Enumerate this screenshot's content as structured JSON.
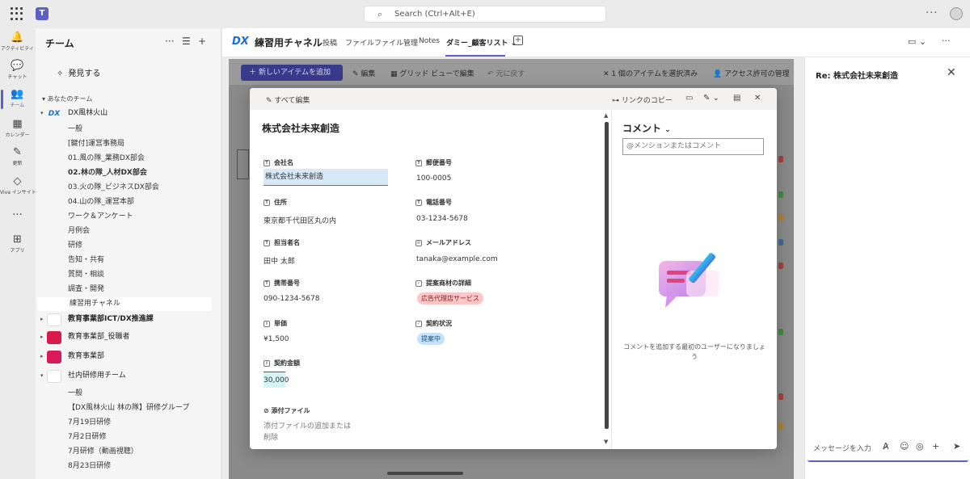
{
  "search": {
    "placeholder": "Search (Ctrl+Alt+E)"
  },
  "app_bar": [
    {
      "label": "アクティビティ",
      "icon": "bell-icon"
    },
    {
      "label": "チャット",
      "icon": "chat-icon"
    },
    {
      "label": "チーム",
      "icon": "teams-icon"
    },
    {
      "label": "カレンダー",
      "icon": "calendar-icon"
    },
    {
      "label": "更新",
      "icon": "updates-icon"
    },
    {
      "label": "Viva インサイト",
      "icon": "viva-icon"
    },
    {
      "label": "アプリ",
      "icon": "apps-icon"
    }
  ],
  "team_panel": {
    "title": "チーム",
    "discover": "発見する",
    "your_teams": "あなたのチーム",
    "rows": [
      {
        "kind": "team",
        "text": "DX風林火山",
        "logo": "DX"
      },
      {
        "kind": "ch",
        "text": "一般"
      },
      {
        "kind": "ch",
        "text": "[鍵付]運営事務局"
      },
      {
        "kind": "ch",
        "text": "01.風の隊_業務DX部会"
      },
      {
        "kind": "ch",
        "text": "02.林の隊_人材DX部会",
        "bold": true
      },
      {
        "kind": "ch",
        "text": "03.火の隊_ビジネスDX部会"
      },
      {
        "kind": "ch",
        "text": "04.山の隊_運営本部"
      },
      {
        "kind": "ch",
        "text": "ワーク＆アンケート"
      },
      {
        "kind": "ch",
        "text": "月例会"
      },
      {
        "kind": "ch",
        "text": "研修"
      },
      {
        "kind": "ch",
        "text": "告知・共有"
      },
      {
        "kind": "ch",
        "text": "質問・相談"
      },
      {
        "kind": "ch",
        "text": "調査・開発"
      },
      {
        "kind": "ch",
        "text": "練習用チャネル",
        "selected": true
      },
      {
        "kind": "team",
        "text": "教育事業部ICT/DX推進課",
        "bold": true
      },
      {
        "kind": "team",
        "text": "教育事業部_役職者"
      },
      {
        "kind": "team",
        "text": "教育事業部"
      },
      {
        "kind": "team",
        "text": "社内研修用チーム"
      },
      {
        "kind": "ch",
        "text": "一般"
      },
      {
        "kind": "ch",
        "text": "【DX風林火山 林の隊】研修グループ"
      },
      {
        "kind": "ch",
        "text": "7月19日研修"
      },
      {
        "kind": "ch",
        "text": "7月2日研修"
      },
      {
        "kind": "ch",
        "text": "7月研修（動画視聴）"
      },
      {
        "kind": "ch",
        "text": "8月23日研修"
      }
    ]
  },
  "header": {
    "logo": "DX",
    "channel": "練習用チャネル",
    "tabs": [
      "投稿",
      "ファイル",
      "ファイル管理",
      "Notes",
      "ダミー_顧客リスト"
    ]
  },
  "list_toolbar": {
    "new_item": "＋ 新しいアイテムを追加",
    "edit": "編集",
    "grid": "グリッド ビューで編集",
    "undo": "元に戻す",
    "selected": "1 個のアイテムを選択済み",
    "access": "アクセス許可の管理"
  },
  "dialog": {
    "edit_all": "すべて編集",
    "copy_link": "リンクのコピー",
    "title": "株式会社未来創造",
    "fields": {
      "company_label": "会社名",
      "company": "株式会社未来創造",
      "zip_label": "郵便番号",
      "zip": "100-0005",
      "address_label": "住所",
      "address": "東京都千代田区丸の内",
      "phone_label": "電話番号",
      "phone": "03-1234-5678",
      "contact_label": "担当者名",
      "contact": "田中 太郎",
      "email_label": "メールアドレス",
      "email": "tanaka@example.com",
      "mobile_label": "携帯番号",
      "mobile": "090-1234-5678",
      "product_label": "提案商材の詳細",
      "product": "広告代理店サービス",
      "price_label": "単価",
      "price": "¥1,500",
      "status_label": "契約状況",
      "status": "提案中",
      "amount_label": "契約金額",
      "amount": "30,000",
      "attach_label": "添付ファイル",
      "attach_line1": "添付ファイルの追加または",
      "attach_line2": "削除"
    },
    "comments": {
      "title": "コメント",
      "placeholder": "@メンションまたはコメント",
      "empty_line1": "コメントを追加する最初のユーザーになりましょ",
      "empty_line2": "う"
    }
  },
  "right_panel": {
    "title": "Re: 株式会社未来創造",
    "placeholder": "メッセージを入力"
  }
}
